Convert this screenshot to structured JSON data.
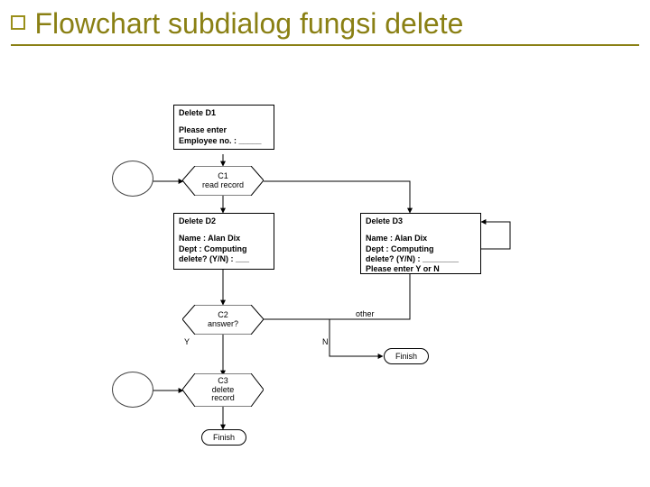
{
  "title": "Flowchart subdialog fungsi delete",
  "d1": {
    "header": "Delete D1",
    "body": "Please enter\nEmployee no. : _____"
  },
  "c1": {
    "l1": "C1",
    "l2": "read record"
  },
  "d2": {
    "header": "Delete D2",
    "body": "Name : Alan Dix\nDept : Computing\ndelete? (Y/N) : ___"
  },
  "d3": {
    "header": "Delete D3",
    "body": "Name : Alan Dix\nDept : Computing\ndelete? (Y/N) : ________\nPlease enter Y or N"
  },
  "c2": {
    "l1": "C2",
    "l2": "answer?"
  },
  "c3": {
    "l1": "C3",
    "l2": "delete",
    "l3": "record"
  },
  "labels": {
    "y": "Y",
    "n": "N",
    "other": "other"
  },
  "finish": "Finish"
}
